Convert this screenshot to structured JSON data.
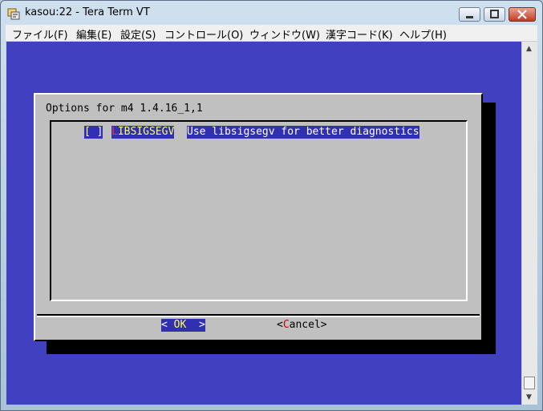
{
  "window": {
    "title": "kasou:22 - Tera Term VT"
  },
  "menu": [
    {
      "label": "ファイル(F)"
    },
    {
      "label": "編集(E)"
    },
    {
      "label": "設定(S)"
    },
    {
      "label": "コントロール(O)"
    },
    {
      "label": "ウィンドウ(W)"
    },
    {
      "label": "漢字コード(K)"
    },
    {
      "label": "ヘルプ(H)"
    }
  ],
  "dialog": {
    "title": "Options for m4 1.4.16_1,1",
    "option": {
      "check": "[ ]",
      "name_first": "L",
      "name_rest": "IBSIGSEGV",
      "description": "Use libsigsegv for better diagnostics"
    },
    "ok": {
      "left": "< ",
      "key": "OK",
      "right": "  >"
    },
    "cancel": {
      "left": "<",
      "key": "C",
      "right": "ancel>"
    }
  },
  "colors": {
    "terminal_bg": "#4040c0",
    "dialog_bg": "#c0c0c0",
    "highlight_bg": "#3030b0",
    "hotkey_yellow": "#ffff55",
    "hotkey_red": "#ff3030"
  },
  "icons": {
    "app": "tera-term-icon",
    "minimize": "minimize-icon",
    "maximize": "maximize-icon",
    "close": "close-icon",
    "scroll_up": "scroll-up-arrow-icon",
    "scroll_down": "scroll-down-arrow-icon"
  }
}
